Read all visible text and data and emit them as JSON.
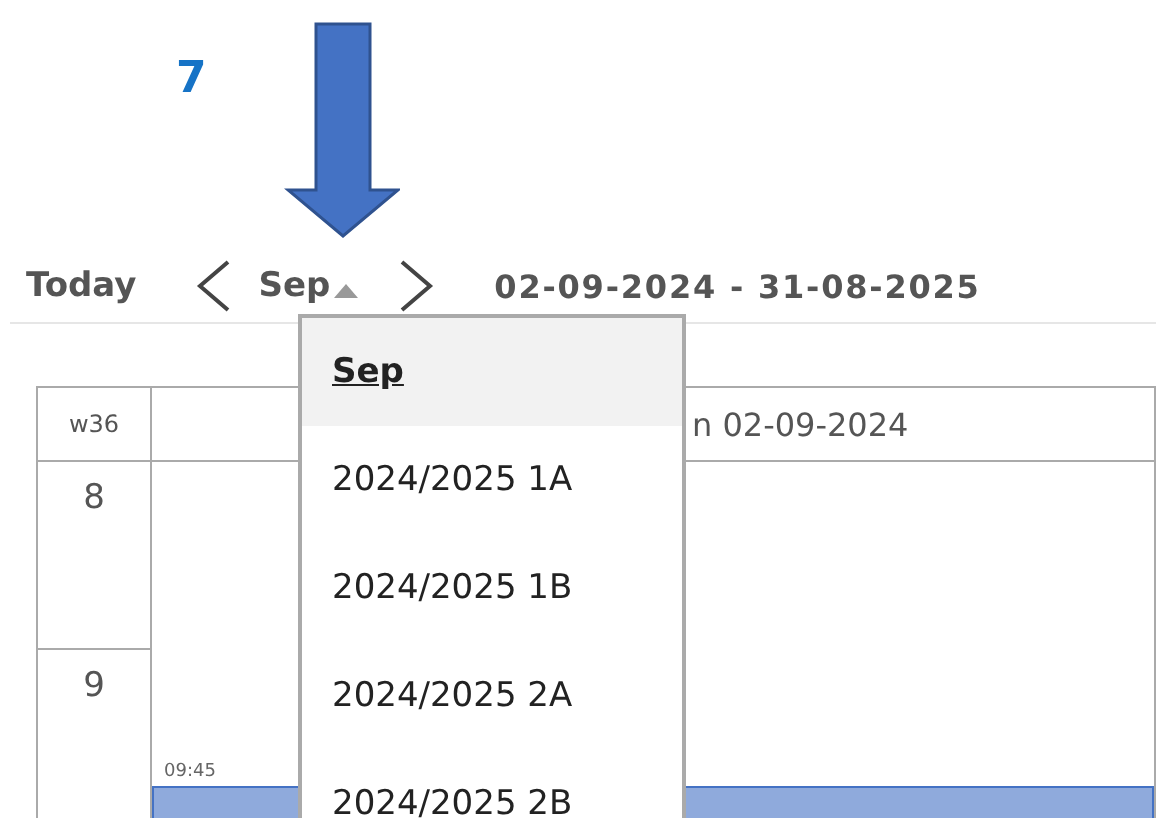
{
  "annotation": {
    "number": "7"
  },
  "toolbar": {
    "today": "Today",
    "period": "Sep",
    "range": "02-09-2024 - 31-08-2025"
  },
  "period_menu": {
    "items": [
      {
        "label": "Sep",
        "selected": true
      },
      {
        "label": "2024/2025 1A",
        "selected": false
      },
      {
        "label": "2024/2025 1B",
        "selected": false
      },
      {
        "label": "2024/2025 2A",
        "selected": false
      },
      {
        "label": "2024/2025 2B",
        "selected": false
      }
    ]
  },
  "calendar": {
    "week": "w36",
    "day_header": "n 02-09-2024",
    "hours": [
      "8",
      "9"
    ],
    "event": {
      "time": "09:45"
    }
  }
}
